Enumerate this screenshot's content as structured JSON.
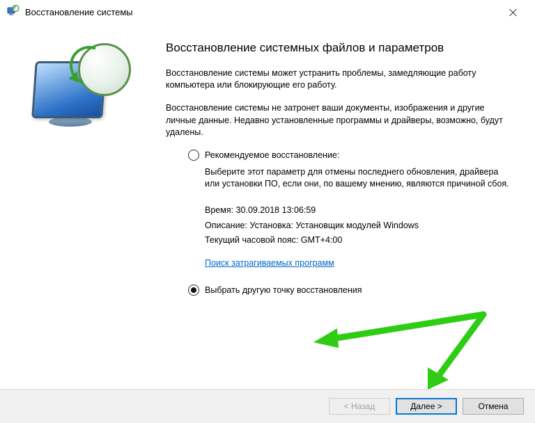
{
  "window": {
    "title": "Восстановление системы"
  },
  "heading": "Восстановление системных файлов и параметров",
  "paragraph1": "Восстановление системы может устранить проблемы, замедляющие работу компьютера или блокирующие его работу.",
  "paragraph2": "Восстановление системы не затронет ваши документы, изображения и другие личные данные. Недавно установленные программы и драйверы, возможно, будут удалены.",
  "options": {
    "recommended": {
      "label": "Рекомендуемое восстановление:",
      "desc": "Выберите этот параметр для отмены последнего обновления, драйвера или установки ПО, если они, по вашему мнению, являются причиной сбоя.",
      "time_label": "Время:",
      "time_value": "30.09.2018 13:06:59",
      "desc_label": "Описание:",
      "desc_value": "Установка: Установщик модулей Windows",
      "tz_label": "Текущий часовой пояс:",
      "tz_value": "GMT+4:00",
      "link": "Поиск затрагиваемых программ"
    },
    "other": {
      "label": "Выбрать другую точку восстановления"
    }
  },
  "buttons": {
    "back": "< Назад",
    "next": "Далее >",
    "cancel": "Отмена"
  }
}
